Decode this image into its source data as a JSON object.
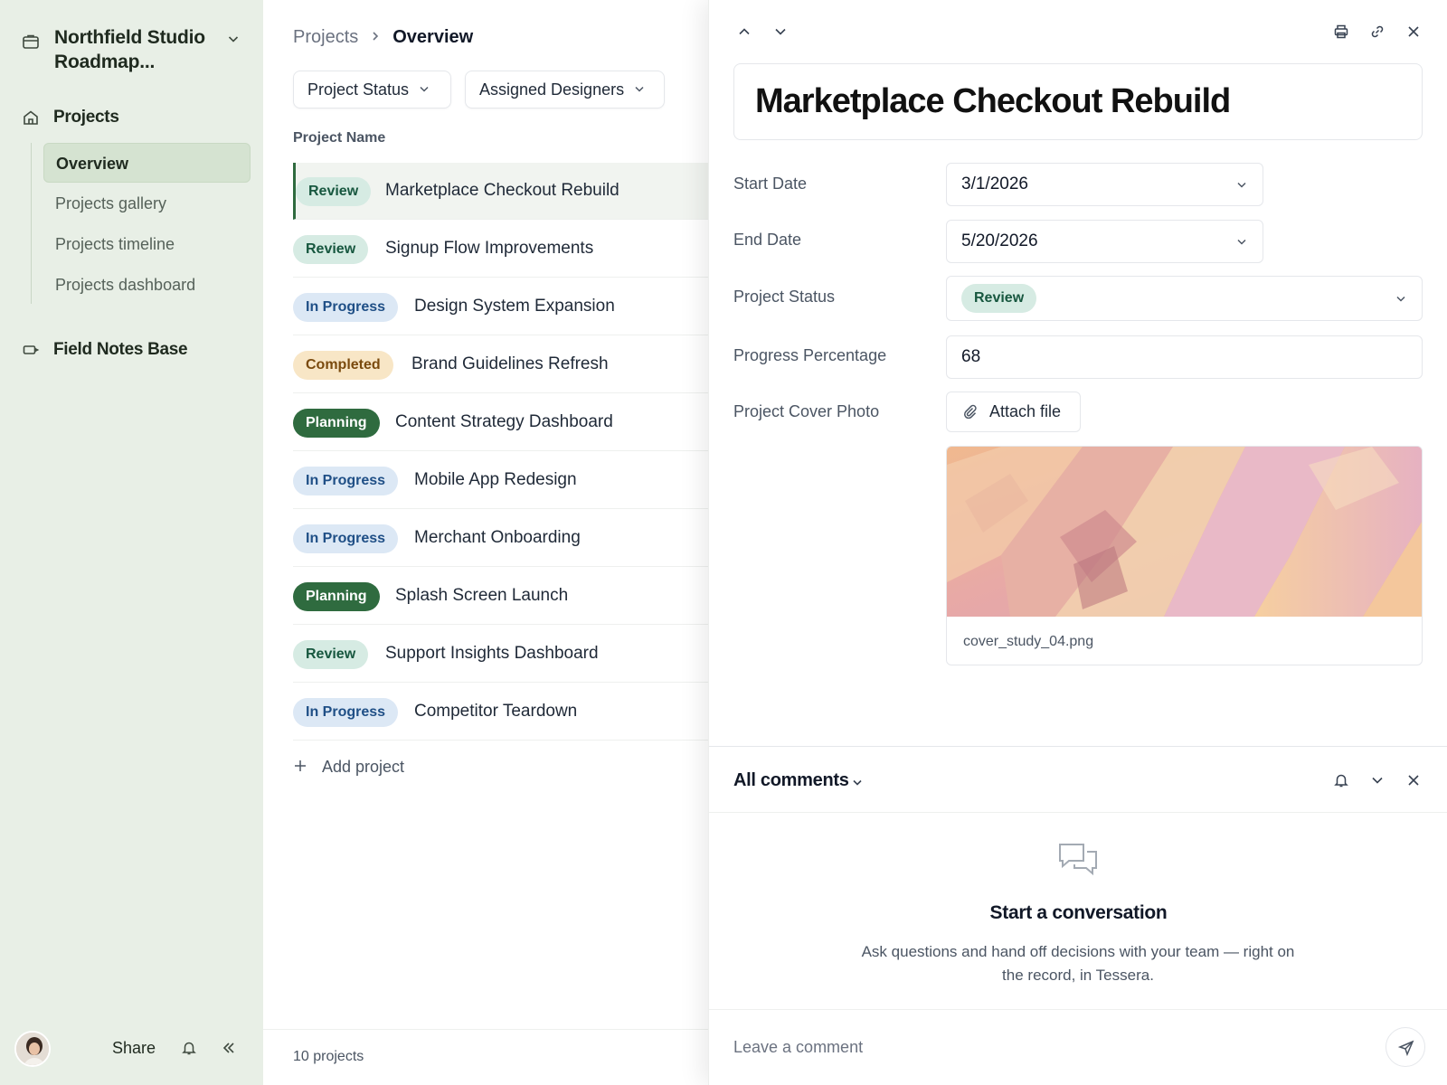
{
  "workspace": {
    "title": "Northfield Studio Roadmap..."
  },
  "sidebar": {
    "sections": [
      {
        "label": "Projects"
      },
      {
        "label": "Field Notes Base"
      }
    ],
    "items": [
      {
        "label": "Overview",
        "active": true
      },
      {
        "label": "Projects gallery"
      },
      {
        "label": "Projects timeline"
      },
      {
        "label": "Projects dashboard"
      }
    ],
    "footer": {
      "share_label": "Share"
    }
  },
  "list": {
    "breadcrumb": {
      "root": "Projects",
      "current": "Overview"
    },
    "filters": [
      {
        "label": "Project Status"
      },
      {
        "label": "Assigned Designers"
      }
    ],
    "column_header": "Project Name",
    "rows": [
      {
        "status": "Review",
        "name": "Marketplace Checkout Rebuild"
      },
      {
        "status": "Review",
        "name": "Signup Flow Improvements"
      },
      {
        "status": "In Progress",
        "name": "Design System Expansion"
      },
      {
        "status": "Completed",
        "name": "Brand Guidelines Refresh"
      },
      {
        "status": "Planning",
        "name": "Content Strategy Dashboard"
      },
      {
        "status": "In Progress",
        "name": "Mobile App Redesign"
      },
      {
        "status": "In Progress",
        "name": "Merchant Onboarding"
      },
      {
        "status": "Planning",
        "name": "Splash Screen Launch"
      },
      {
        "status": "Review",
        "name": "Support Insights Dashboard"
      },
      {
        "status": "In Progress",
        "name": "Competitor Teardown"
      }
    ],
    "add_label": "Add project",
    "count_label": "10 projects"
  },
  "detail": {
    "title": "Marketplace Checkout Rebuild",
    "fields": {
      "start_date": {
        "label": "Start Date",
        "value": "3/1/2026"
      },
      "end_date": {
        "label": "End Date",
        "value": "5/20/2026"
      },
      "status": {
        "label": "Project Status",
        "value": "Review"
      },
      "progress": {
        "label": "Progress Percentage",
        "value": "68"
      },
      "cover": {
        "label": "Project Cover Photo",
        "attach_label": "Attach file",
        "file_name": "cover_study_04.png"
      }
    },
    "comments": {
      "title": "All comments",
      "empty_title": "Start a conversation",
      "empty_desc": "Ask questions and hand off decisions with your team — right on the record, in Tessera.",
      "placeholder": "Leave a comment"
    }
  },
  "colors": {
    "sidebar_bg": "#e8efe6",
    "accent_green": "#2f6b3f",
    "review_bg": "#d6ebe3",
    "progress_bg": "#dce8f5",
    "completed_bg": "#f8e6c6"
  }
}
